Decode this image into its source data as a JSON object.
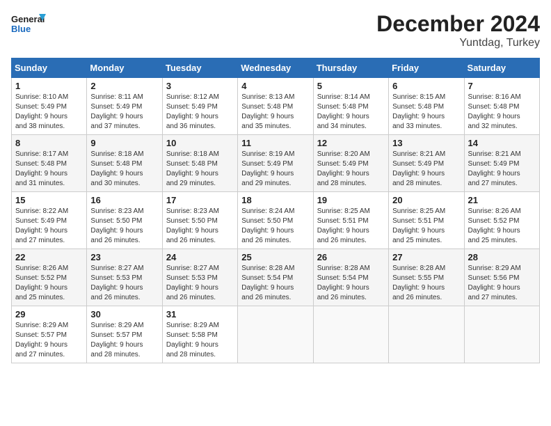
{
  "header": {
    "logo_line1": "General",
    "logo_line2": "Blue",
    "month": "December 2024",
    "location": "Yuntdag, Turkey"
  },
  "weekdays": [
    "Sunday",
    "Monday",
    "Tuesday",
    "Wednesday",
    "Thursday",
    "Friday",
    "Saturday"
  ],
  "weeks": [
    [
      {
        "day": "1",
        "info": "Sunrise: 8:10 AM\nSunset: 5:49 PM\nDaylight: 9 hours\nand 38 minutes."
      },
      {
        "day": "2",
        "info": "Sunrise: 8:11 AM\nSunset: 5:49 PM\nDaylight: 9 hours\nand 37 minutes."
      },
      {
        "day": "3",
        "info": "Sunrise: 8:12 AM\nSunset: 5:49 PM\nDaylight: 9 hours\nand 36 minutes."
      },
      {
        "day": "4",
        "info": "Sunrise: 8:13 AM\nSunset: 5:48 PM\nDaylight: 9 hours\nand 35 minutes."
      },
      {
        "day": "5",
        "info": "Sunrise: 8:14 AM\nSunset: 5:48 PM\nDaylight: 9 hours\nand 34 minutes."
      },
      {
        "day": "6",
        "info": "Sunrise: 8:15 AM\nSunset: 5:48 PM\nDaylight: 9 hours\nand 33 minutes."
      },
      {
        "day": "7",
        "info": "Sunrise: 8:16 AM\nSunset: 5:48 PM\nDaylight: 9 hours\nand 32 minutes."
      }
    ],
    [
      {
        "day": "8",
        "info": "Sunrise: 8:17 AM\nSunset: 5:48 PM\nDaylight: 9 hours\nand 31 minutes."
      },
      {
        "day": "9",
        "info": "Sunrise: 8:18 AM\nSunset: 5:48 PM\nDaylight: 9 hours\nand 30 minutes."
      },
      {
        "day": "10",
        "info": "Sunrise: 8:18 AM\nSunset: 5:48 PM\nDaylight: 9 hours\nand 29 minutes."
      },
      {
        "day": "11",
        "info": "Sunrise: 8:19 AM\nSunset: 5:49 PM\nDaylight: 9 hours\nand 29 minutes."
      },
      {
        "day": "12",
        "info": "Sunrise: 8:20 AM\nSunset: 5:49 PM\nDaylight: 9 hours\nand 28 minutes."
      },
      {
        "day": "13",
        "info": "Sunrise: 8:21 AM\nSunset: 5:49 PM\nDaylight: 9 hours\nand 28 minutes."
      },
      {
        "day": "14",
        "info": "Sunrise: 8:21 AM\nSunset: 5:49 PM\nDaylight: 9 hours\nand 27 minutes."
      }
    ],
    [
      {
        "day": "15",
        "info": "Sunrise: 8:22 AM\nSunset: 5:49 PM\nDaylight: 9 hours\nand 27 minutes."
      },
      {
        "day": "16",
        "info": "Sunrise: 8:23 AM\nSunset: 5:50 PM\nDaylight: 9 hours\nand 26 minutes."
      },
      {
        "day": "17",
        "info": "Sunrise: 8:23 AM\nSunset: 5:50 PM\nDaylight: 9 hours\nand 26 minutes."
      },
      {
        "day": "18",
        "info": "Sunrise: 8:24 AM\nSunset: 5:50 PM\nDaylight: 9 hours\nand 26 minutes."
      },
      {
        "day": "19",
        "info": "Sunrise: 8:25 AM\nSunset: 5:51 PM\nDaylight: 9 hours\nand 26 minutes."
      },
      {
        "day": "20",
        "info": "Sunrise: 8:25 AM\nSunset: 5:51 PM\nDaylight: 9 hours\nand 25 minutes."
      },
      {
        "day": "21",
        "info": "Sunrise: 8:26 AM\nSunset: 5:52 PM\nDaylight: 9 hours\nand 25 minutes."
      }
    ],
    [
      {
        "day": "22",
        "info": "Sunrise: 8:26 AM\nSunset: 5:52 PM\nDaylight: 9 hours\nand 25 minutes."
      },
      {
        "day": "23",
        "info": "Sunrise: 8:27 AM\nSunset: 5:53 PM\nDaylight: 9 hours\nand 26 minutes."
      },
      {
        "day": "24",
        "info": "Sunrise: 8:27 AM\nSunset: 5:53 PM\nDaylight: 9 hours\nand 26 minutes."
      },
      {
        "day": "25",
        "info": "Sunrise: 8:28 AM\nSunset: 5:54 PM\nDaylight: 9 hours\nand 26 minutes."
      },
      {
        "day": "26",
        "info": "Sunrise: 8:28 AM\nSunset: 5:54 PM\nDaylight: 9 hours\nand 26 minutes."
      },
      {
        "day": "27",
        "info": "Sunrise: 8:28 AM\nSunset: 5:55 PM\nDaylight: 9 hours\nand 26 minutes."
      },
      {
        "day": "28",
        "info": "Sunrise: 8:29 AM\nSunset: 5:56 PM\nDaylight: 9 hours\nand 27 minutes."
      }
    ],
    [
      {
        "day": "29",
        "info": "Sunrise: 8:29 AM\nSunset: 5:57 PM\nDaylight: 9 hours\nand 27 minutes."
      },
      {
        "day": "30",
        "info": "Sunrise: 8:29 AM\nSunset: 5:57 PM\nDaylight: 9 hours\nand 28 minutes."
      },
      {
        "day": "31",
        "info": "Sunrise: 8:29 AM\nSunset: 5:58 PM\nDaylight: 9 hours\nand 28 minutes."
      },
      {
        "day": "",
        "info": ""
      },
      {
        "day": "",
        "info": ""
      },
      {
        "day": "",
        "info": ""
      },
      {
        "day": "",
        "info": ""
      }
    ]
  ]
}
